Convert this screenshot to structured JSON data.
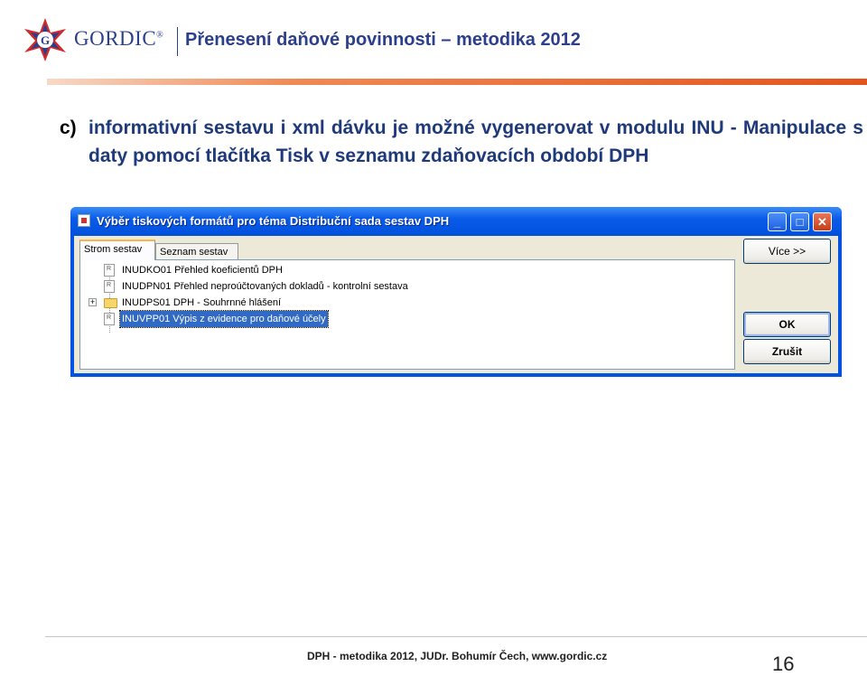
{
  "header": {
    "brand": "GORDIC",
    "brand_mark": "®",
    "title": "Přenesení daňové povinnosti – metodika 2012"
  },
  "content": {
    "marker": "c)",
    "text": "informativní sestavu i xml dávku je možné vygenerovat v modulu INU - Manipulace s daty pomocí tlačítka Tisk v seznamu zdaňovacích období DPH"
  },
  "dialog": {
    "title": "Výběr tiskových formátů pro téma Distribuční sada sestav DPH",
    "caption_buttons": {
      "minimize": "_",
      "maximize": "□",
      "close": "✕"
    },
    "tabs": [
      {
        "label": "Strom sestav",
        "active": true
      },
      {
        "label": "Seznam sestav",
        "active": false
      }
    ],
    "tree": [
      {
        "label": "INUDKO01  Přehled koeficientů DPH",
        "icon": "report-icon",
        "selected": false
      },
      {
        "label": "INUDPN01  Přehled neproúčtovaných dokladů - kontrolní sestava",
        "icon": "report-icon",
        "selected": false
      },
      {
        "label": "INUDPS01  DPH - Souhrnné hlášení",
        "icon": "folder-icon",
        "expander": "+",
        "selected": false
      },
      {
        "label": "INUVPP01  Výpis z evidence pro daňové účely",
        "icon": "report-icon",
        "selected": true
      }
    ],
    "buttons": {
      "more": "Více >>",
      "ok": "OK",
      "cancel": "Zrušit"
    }
  },
  "footer": {
    "text": "DPH - metodika 2012, JUDr. Bohumír Čech, www.gordic.cz",
    "page": "16"
  },
  "colors": {
    "brand_blue": "#2b3f8c",
    "accent_orange": "#e4541d",
    "selection": "#316ac5",
    "titlebar": "#0050dc"
  }
}
